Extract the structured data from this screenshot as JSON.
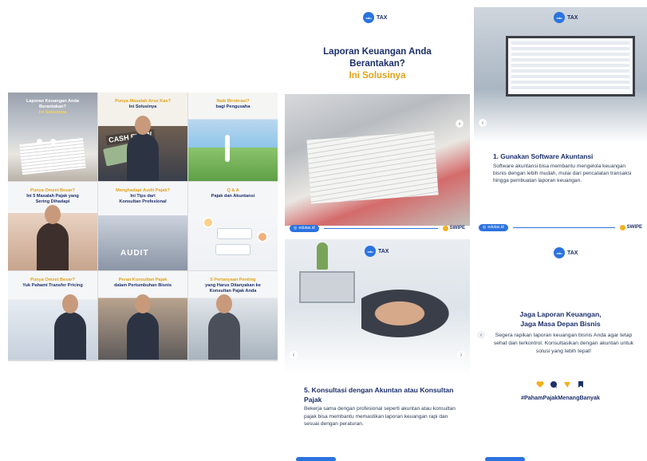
{
  "brand": {
    "logo_badge": "edu",
    "logo_text": "TAX"
  },
  "grid": {
    "tiles": [
      {
        "l1": "Laporan Keuangan Anda",
        "l2": "Berantakan?",
        "l3": "Ini Solusinya"
      },
      {
        "l1": "Punya Masalah Arus Kas?",
        "l2": "Ini Solusinya"
      },
      {
        "l1": "Naik Birokrasi?",
        "l2": "bagi Pengusaha"
      },
      {
        "l1": "Punya Omzet Besar?",
        "l2": "Ini 5 Masalah Pajak yang",
        "l3": "Sering Dihadapi"
      },
      {
        "l1": "Menghadapi Audit Pajak?",
        "l2": "Ini Tips dari",
        "l3": "Konsultan Profesional"
      },
      {
        "l1": "Q & A",
        "l2": "Pajak dan Akuntansi"
      },
      {
        "l1": "Punya Omzet Besar?",
        "l2": "Yuk Pahami Transfer Pricing"
      },
      {
        "l1": "Peran Konsultan Pajak",
        "l2": "dalam Pertumbuhan Bisnis"
      },
      {
        "l1": "5 Pertanyaan Penting",
        "l2": "yang Harus Ditanyakan ke",
        "l3": "Konsultan Pajak Anda"
      }
    ],
    "cashflow_label": "CASH FLOW",
    "audit_label": "AUDIT"
  },
  "panel1": {
    "headline_line1": "Laporan Keuangan Anda",
    "headline_line2": "Berantakan?",
    "headline_highlight": "Ini Solusinya",
    "handle": "edutax.id",
    "swipe": "SWIPE"
  },
  "panel2": {
    "title": "1. Gunakan Software Akuntansi",
    "body": "Software akuntansi bisa membantu mengelola keuangan bisnis dengan lebih mudah, mulai dari pencatatan transaksi hingga pembuatan laporan keuangan.",
    "handle": "edutax.id",
    "swipe": "SWIPE"
  },
  "panel3": {
    "title": "5. Konsultasi dengan Akuntan atau Konsultan Pajak",
    "body": "Bekerja sama dengan profesional seperti akuntan atau konsultan pajak bisa membantu memastikan laporan keuangan rapi dan sesuai dengan peraturan."
  },
  "panel4": {
    "headline_line1": "Jaga Laporan Keuangan,",
    "headline_line2": "Jaga Masa Depan Bisnis",
    "body": "Segera rapikan laporan keuangan bisnis Anda agar tetap sehat dan terkontrol. Konsultasikan dengan akuntan untuk solusi yang lebih tepat!",
    "hashtag": "#PahamPajakMenangBanyak",
    "icons": [
      "heart-icon",
      "comment-icon",
      "share-icon",
      "bookmark-icon"
    ]
  },
  "colors": {
    "navy": "#1c2f6b",
    "accent": "#e0a21a",
    "blue": "#2c73e0"
  }
}
